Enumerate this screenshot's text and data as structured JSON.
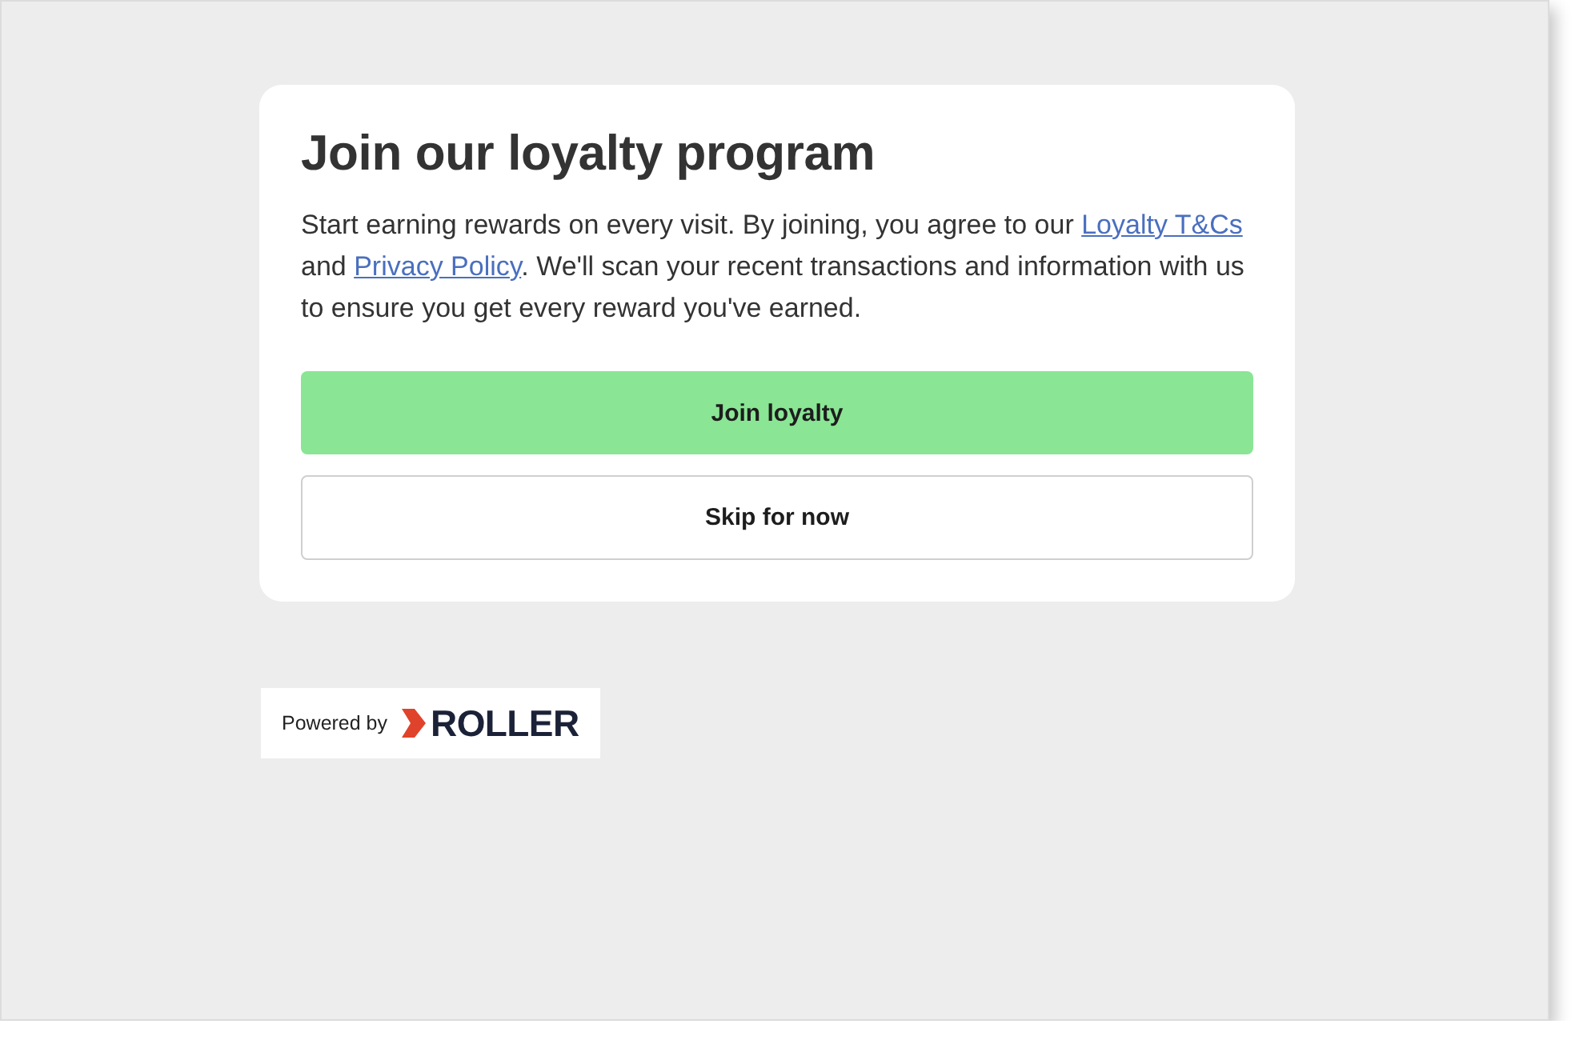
{
  "card": {
    "title": "Join our loyalty program",
    "intro": [
      {
        "kind": "text",
        "text": "Start earning rewards on every visit. By joining, you agree to our "
      },
      {
        "kind": "link",
        "text": "Loyalty T&Cs"
      },
      {
        "kind": "text",
        "text": " and "
      },
      {
        "kind": "link",
        "text": "Privacy Policy"
      },
      {
        "kind": "text",
        "text": ". We'll scan your recent transactions and information with us to ensure you get every reward you've earned."
      }
    ],
    "buttons": [
      {
        "kind": "primary",
        "label": "Join loyalty"
      },
      {
        "kind": "secondary",
        "label": "Skip for now"
      }
    ]
  },
  "footer": {
    "powered_by": "Powered by",
    "brand": "ROLLER"
  }
}
